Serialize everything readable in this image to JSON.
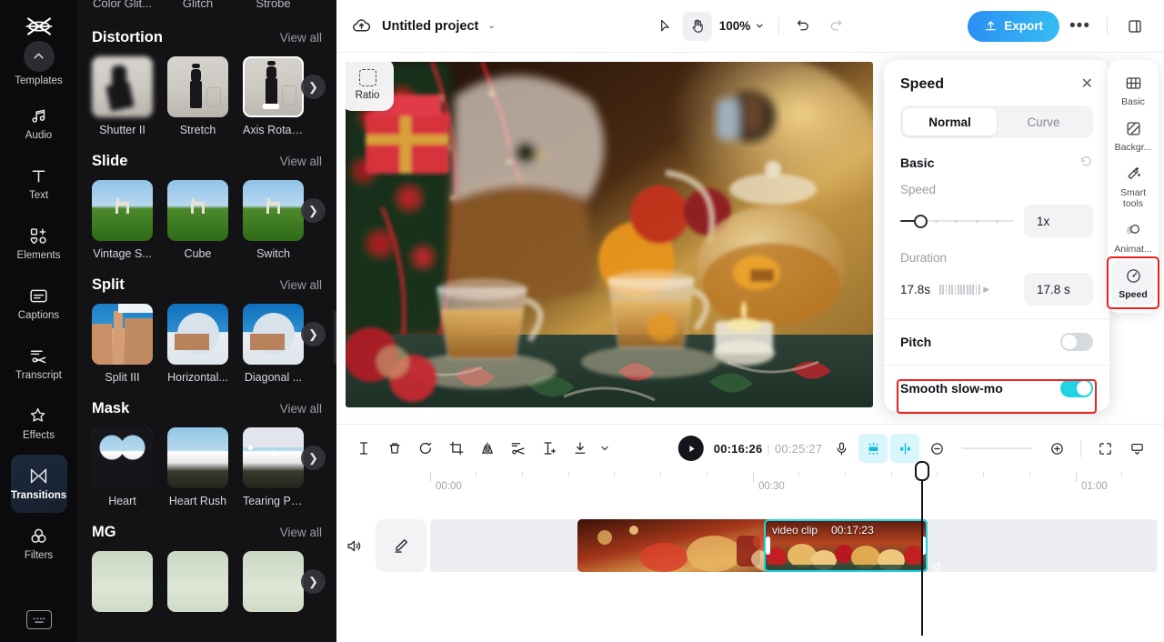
{
  "sidebar": {
    "logo_name": "capcut-logo",
    "items": [
      {
        "label": "Templates",
        "icon": "chevron-up-circle-icon"
      },
      {
        "label": "Audio",
        "icon": "music-note-icon"
      },
      {
        "label": "Text",
        "icon": "text-t-icon"
      },
      {
        "label": "Elements",
        "icon": "elements-icon"
      },
      {
        "label": "Captions",
        "icon": "captions-icon"
      },
      {
        "label": "Transcript",
        "icon": "transcript-icon"
      },
      {
        "label": "Effects",
        "icon": "sparkle-star-icon"
      },
      {
        "label": "Transitions",
        "icon": "transitions-icon"
      },
      {
        "label": "Filters",
        "icon": "filters-circles-icon"
      }
    ],
    "bottom_icon": "keyboard-icon"
  },
  "panel": {
    "cutoff_row": [
      "Color Glit...",
      "Glitch",
      "Strobe"
    ],
    "view_all": "View all",
    "sections": [
      {
        "title": "Distortion",
        "items": [
          {
            "label": "Shutter II",
            "art": "fashion-blur"
          },
          {
            "label": "Stretch",
            "art": "fashion"
          },
          {
            "label": "Axis Rotat...",
            "art": "fashion",
            "selected": true
          }
        ]
      },
      {
        "title": "Slide",
        "items": [
          {
            "label": "Vintage S...",
            "art": "grass"
          },
          {
            "label": "Cube",
            "art": "grass"
          },
          {
            "label": "Switch",
            "art": "grass"
          }
        ]
      },
      {
        "title": "Split",
        "items": [
          {
            "label": "Split III",
            "art": "morocco"
          },
          {
            "label": "Horizontal...",
            "art": "dome"
          },
          {
            "label": "Diagonal ...",
            "art": "dome"
          }
        ]
      },
      {
        "title": "Mask",
        "items": [
          {
            "label": "Heart",
            "art": "mountain-heart"
          },
          {
            "label": "Heart Rush",
            "art": "mountain"
          },
          {
            "label": "Tearing Pa...",
            "art": "mountain-tear"
          }
        ]
      },
      {
        "title": "MG",
        "items": [
          {
            "label": "",
            "art": "mg"
          },
          {
            "label": "",
            "art": "mg"
          },
          {
            "label": "",
            "art": "mg"
          }
        ]
      }
    ]
  },
  "topbar": {
    "cloud_icon": "cloud-upload-icon",
    "project_name": "Untitled project",
    "caret": "⌄",
    "select_tool": "cursor-arrow-icon",
    "hand_tool": "hand-icon",
    "zoom_level": "100%",
    "undo_icon": "undo-icon",
    "redo_icon": "redo-icon",
    "export_label": "Export",
    "more_label": "•••",
    "layout_icon": "panel-layout-icon"
  },
  "preview": {
    "ratio_label": "Ratio",
    "ratio_icon": "dashed-square-icon"
  },
  "speed_panel": {
    "title": "Speed",
    "close_icon": "close-x-icon",
    "tabs": [
      {
        "label": "Normal",
        "active": true
      },
      {
        "label": "Curve",
        "active": false
      }
    ],
    "basic_label": "Basic",
    "reset_icon": "reset-circle-icon",
    "speed_label": "Speed",
    "speed_value": "1x",
    "duration_label": "Duration",
    "duration_left": "17.8s",
    "duration_value": "17.8 s",
    "pitch_label": "Pitch",
    "pitch_on": false,
    "smooth_label": "Smooth slow-mo",
    "smooth_on": true,
    "accent": "#20d4e4",
    "highlight": "#f02020"
  },
  "toolrail": {
    "items": [
      {
        "label": "Basic",
        "icon": "film-grid-icon",
        "active": false
      },
      {
        "label": "Backgr...",
        "icon": "background-icon",
        "active": false
      },
      {
        "label": "Smart tools",
        "icon": "magic-wand-icon",
        "active": false
      },
      {
        "label": "Animat...",
        "icon": "animation-circles-icon",
        "active": false
      },
      {
        "label": "Speed",
        "icon": "speedometer-icon",
        "active": true
      }
    ]
  },
  "timeline": {
    "tools": [
      {
        "name": "split-icon"
      },
      {
        "name": "delete-trash-icon"
      },
      {
        "name": "rotate-icon"
      },
      {
        "name": "crop-icon"
      },
      {
        "name": "mirror-flip-icon"
      },
      {
        "name": "cut-scissors-icon"
      },
      {
        "name": "freeze-frame-icon"
      },
      {
        "name": "download-icon"
      },
      {
        "name": "chevron-down-icon"
      }
    ],
    "play_icon": "play-icon",
    "current_time": "00:16:26",
    "total_time": "00:25:27",
    "separator": "|",
    "right_tools": [
      {
        "name": "microphone-icon",
        "active": false
      },
      {
        "name": "auto-enhance-icon",
        "active": true
      },
      {
        "name": "audio-split-icon",
        "active": true
      }
    ],
    "zoom_out_icon": "zoom-out-icon",
    "zoom_in_icon": "zoom-in-icon",
    "fit-icon": "fit-screen-icon",
    "marker_icon": "marker-icon",
    "ruler_labels": [
      "00:00",
      "00:30",
      "01:00"
    ],
    "speaker_icon": "speaker-icon",
    "edit_icon": "pencil-edit-icon",
    "clips": [
      {
        "name": "video clip",
        "duration": "00:17:23",
        "selected": true
      },
      {
        "name": "",
        "duration": "",
        "selected": false
      }
    ],
    "transition_icon": "transition-triangle-icon"
  }
}
